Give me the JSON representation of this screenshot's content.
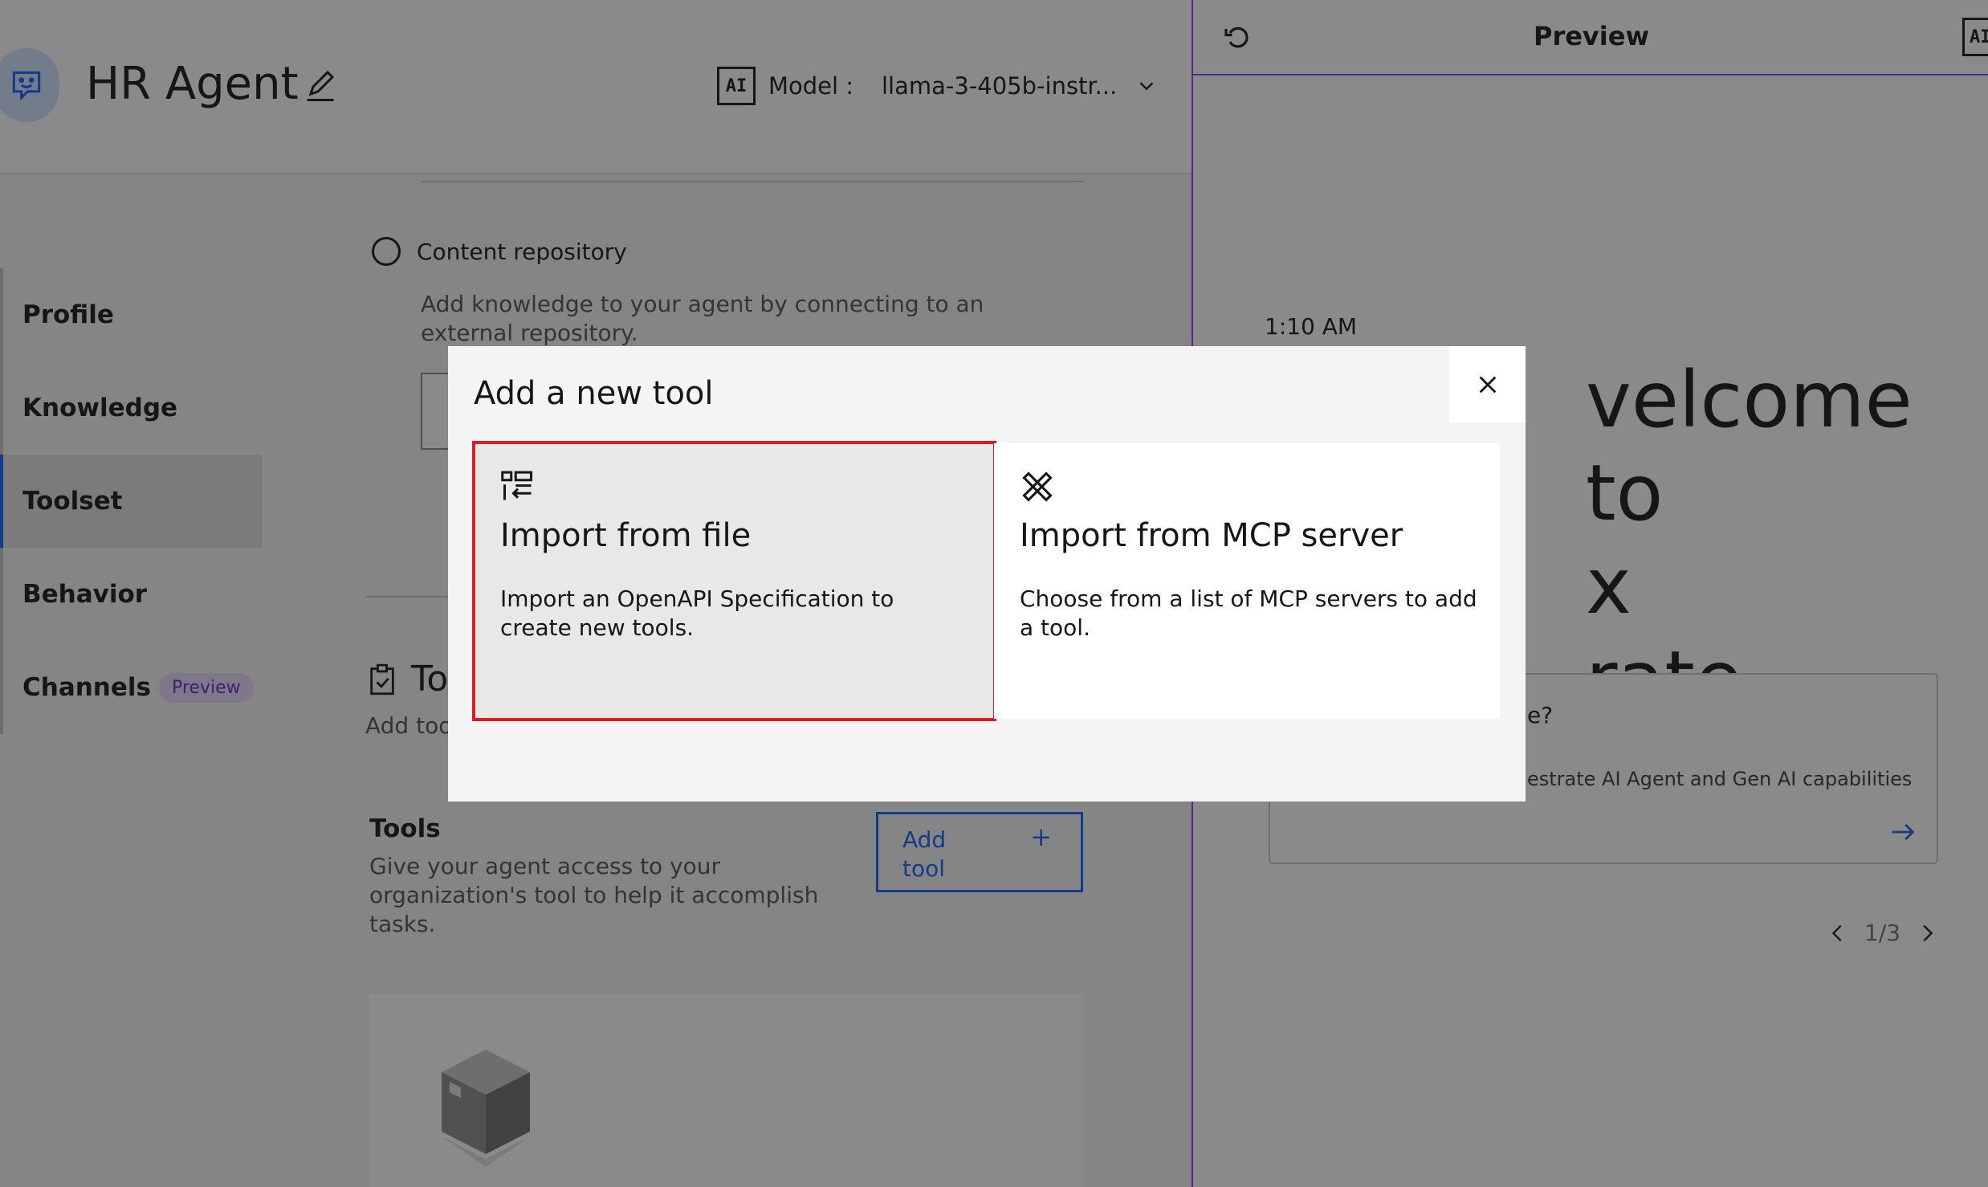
{
  "header": {
    "agent_name": "HR Agent",
    "ai_badge": "AI",
    "model_label": "Model :",
    "model_value": "llama-3-405b-instr..."
  },
  "nav": {
    "items": [
      {
        "label": "Profile"
      },
      {
        "label": "Knowledge"
      },
      {
        "label": "Toolset"
      },
      {
        "label": "Behavior"
      },
      {
        "label": "Channels",
        "tag": "Preview"
      }
    ],
    "active": "Toolset"
  },
  "knowledge": {
    "option_label": "Content repository",
    "option_desc": "Add knowledge to your agent by connecting to an external repository."
  },
  "toolset": {
    "title": "To",
    "subtitle": "Add tool",
    "tools_heading": "Tools",
    "tools_desc": "Give your agent access to your organization's tool to help it accomplish tasks.",
    "add_tool_label": "Add tool",
    "add_tool_plus": "+"
  },
  "preview": {
    "title": "Preview",
    "ai_badge": "AI",
    "time": "1:10 AM",
    "welcome_text": "velcome to\n(\nrate",
    "suggestion_question": "e?",
    "suggestion_desc": "estrate AI Agent and Gen AI capabilities",
    "pager": "1/3"
  },
  "modal": {
    "title": "Add a new tool",
    "options": [
      {
        "title": "Import from file",
        "desc": "Import an OpenAPI Specification to create new tools.",
        "icon": "import-file-icon"
      },
      {
        "title": "Import from MCP server",
        "desc": "Choose from a list of MCP servers to add a tool.",
        "icon": "mcp-tools-icon"
      }
    ]
  },
  "colors": {
    "accent": "#0f62fe",
    "selection_outline": "#da1e28",
    "preview_border": "#8a3ffc",
    "tag_bg": "#e8daff"
  }
}
